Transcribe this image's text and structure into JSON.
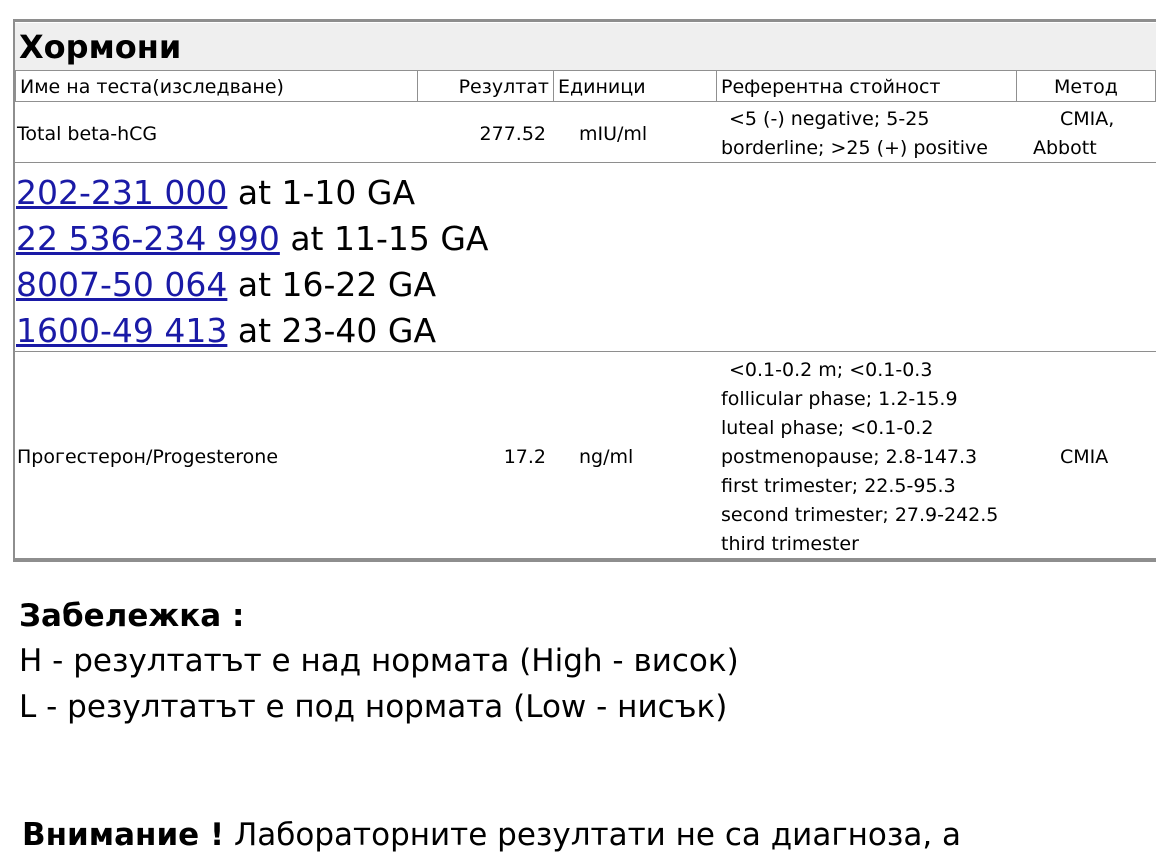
{
  "section": {
    "title": "Хормони"
  },
  "table": {
    "headers": {
      "test_name": "Име на теста(изследване)",
      "result": "Резултат",
      "units": "Единици",
      "reference": "Референтна стойност",
      "method": "Метод"
    },
    "rows": [
      {
        "name": "Total beta-hCG",
        "result": "277.52",
        "units": "mIU/ml",
        "reference_lines": [
          "<5 (-) negative; 5-25",
          "borderline; >25 (+) positive"
        ],
        "method_lines": [
          "CMIA,",
          "Abbott"
        ]
      },
      {
        "name": "Прогестерон/Progesterone",
        "result": "17.2",
        "units": "ng/ml",
        "reference_lines": [
          "<0.1-0.2 m; <0.1-0.3",
          "follicular phase; 1.2-15.9",
          "luteal phase; <0.1-0.2",
          "postmenopause; 2.8-147.3",
          "first trimester; 22.5-95.3",
          "second trimester; 27.9-242.5",
          "third trimester"
        ],
        "method": "CMIA"
      }
    ],
    "hcg_ranges": [
      {
        "range": "202-231 000",
        "suffix": " at 1-10 GA"
      },
      {
        "range": "22 536-234 990",
        "suffix": " at 11-15 GA"
      },
      {
        "range": "8007-50 064",
        "suffix": " at 16-22 GA"
      },
      {
        "range": "1600-49 413",
        "suffix": " at 23-40 GA"
      }
    ]
  },
  "note": {
    "title": "Забележка :",
    "lines": [
      "H - резултатът е над нормата (High - висок)",
      "L - резултатът е под нормата (Low - нисък)"
    ]
  },
  "warning": {
    "label": "Внимание !",
    "text": " Лабораторните резултати не са диагноза, а"
  },
  "colors": {
    "link": "#1a1aa6",
    "header_bg": "#efefef",
    "border": "#8e8e8e"
  }
}
